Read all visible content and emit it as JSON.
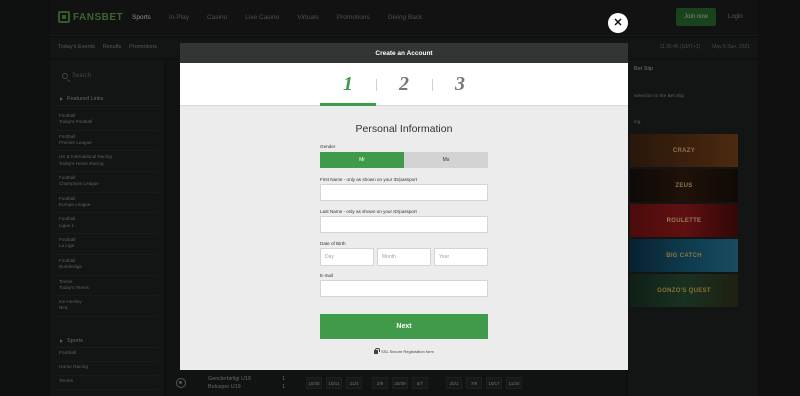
{
  "site": {
    "brand": "FANSBET",
    "nav": [
      "Sports",
      "In-Play",
      "Casino",
      "Live Casino",
      "Virtuals",
      "Promotions",
      "Giving Back"
    ],
    "join_label": "Join now",
    "login_label": "Login",
    "subnav": [
      "Today's Events",
      "Results",
      "Promotions"
    ],
    "time": "11:35:45 (GMT+1)",
    "date": "May 9 Sun, 2021"
  },
  "sidebar": {
    "search_placeholder": "Search",
    "featured_title": "Featured Links",
    "featured": [
      {
        "category": "Football",
        "name": "Today's Football"
      },
      {
        "category": "Football",
        "name": "Premier League"
      },
      {
        "category": "UK & International Racing",
        "name": "Today's Horse Racing"
      },
      {
        "category": "Football",
        "name": "Champions League"
      },
      {
        "category": "Football",
        "name": "Europa League"
      },
      {
        "category": "Football",
        "name": "Ligue 1"
      },
      {
        "category": "Football",
        "name": "La Liga"
      },
      {
        "category": "Football",
        "name": "Bundesliga"
      },
      {
        "category": "Tennis",
        "name": "Today's Tennis"
      },
      {
        "category": "Ice Hockey",
        "name": "NHL"
      }
    ],
    "sports_title": "Sports",
    "sports": [
      "Football",
      "Horse Racing",
      "Tennis"
    ]
  },
  "event_row": {
    "team_home": "Genclerbirligi U19",
    "team_away": "Boluspor U19",
    "score_home": "1",
    "score_away": "1",
    "odds": [
      "10/30",
      "10/11",
      "11/4",
      "2/9",
      "20/39",
      "5/7",
      "20/1",
      "7/9",
      "10/17",
      "11/20"
    ]
  },
  "right_panel": {
    "betslip_title": "Bet Slip",
    "betslip_info": "selection to the Bet Slip",
    "gaming_label": "ing",
    "games": [
      "CRAZY",
      "ZEUS",
      "ROULETTE",
      "BIG CATCH",
      "GONZO'S QUEST"
    ]
  },
  "modal": {
    "title": "Create an Account",
    "steps": [
      "1",
      "2",
      "3"
    ],
    "active_step": 1,
    "section_title": "Personal Information",
    "gender_label": "Gender",
    "gender_options": [
      "Mr",
      "Ms"
    ],
    "gender_selected": "Mr",
    "first_name_label": "First Name - only as shown on your ID/passport",
    "first_name_value": "",
    "last_name_label": "Last Name - only as shown on your ID/passport",
    "last_name_value": "",
    "dob_label": "Date of Birth",
    "dob_placeholders": {
      "day": "Day",
      "month": "Month",
      "year": "Year"
    },
    "email_label": "E-mail",
    "email_value": "",
    "next_label": "Next",
    "secure_text": "SSL Secure Registration form",
    "close_symbol": "✕"
  },
  "colors": {
    "accent_green": "#3f9b4a",
    "modal_header": "#333534",
    "backdrop": "#1b1d1c"
  }
}
